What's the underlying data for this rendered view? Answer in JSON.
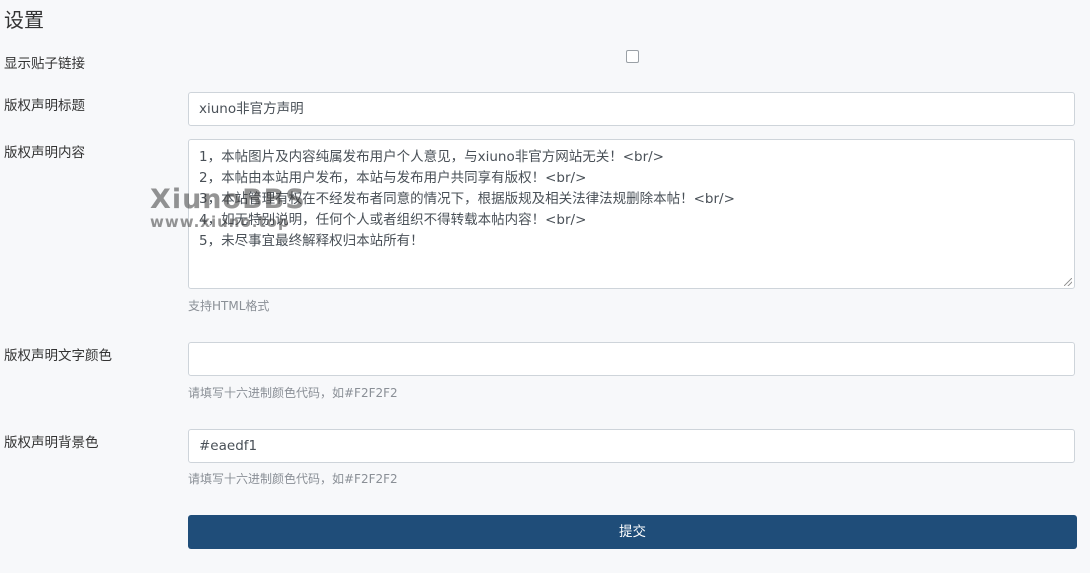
{
  "page": {
    "title": "设置"
  },
  "form": {
    "show_link": {
      "label": "显示贴子链接",
      "checked": false
    },
    "copyright_title": {
      "label": "版权声明标题",
      "value": "xiuno非官方声明"
    },
    "copyright_content": {
      "label": "版权声明内容",
      "lines": [
        "1，本帖图片及内容纯属发布用户个人意见，与xiuno非官方网站无关！<br/>",
        "2，本帖由本站用户发布，本站与发布用户共同享有版权！<br/>",
        "3，本站管理有权在不经发布者同意的情况下，根据版规及相关法律法规删除本帖！<br/>",
        "4，如无特别说明，任何个人或者组织不得转载本帖内容！<br/>",
        "5，未尽事宜最终解释权归本站所有！"
      ],
      "help": "支持HTML格式"
    },
    "text_color": {
      "label": "版权声明文字颜色",
      "value": "",
      "help": "请填写十六进制颜色代码，如#F2F2F2"
    },
    "bg_color": {
      "label": "版权声明背景色",
      "value": "#eaedf1",
      "help": "请填写十六进制颜色代码，如#F2F2F2"
    },
    "submit_label": "提交"
  },
  "watermark": {
    "logo": "XiunoBBS",
    "url": "www.xiuno.top"
  },
  "colors": {
    "primary_button": "#1f4d79",
    "background": "#f7f8fa"
  }
}
